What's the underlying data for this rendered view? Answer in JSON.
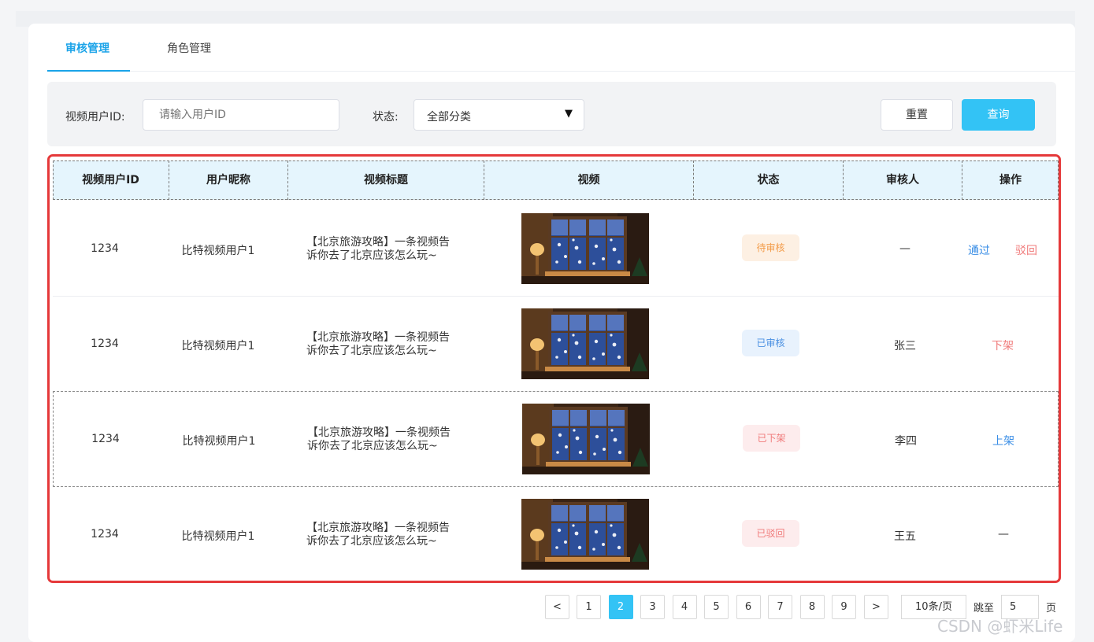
{
  "tabs": [
    {
      "label": "审核管理",
      "active": true
    },
    {
      "label": "角色管理",
      "active": false
    }
  ],
  "filter": {
    "user_id_label": "视频用户ID:",
    "user_id_placeholder": "请输入用户ID",
    "status_label": "状态:",
    "status_value": "全部分类",
    "reset_label": "重置",
    "query_label": "查询"
  },
  "table": {
    "headers": [
      "视频用户ID",
      "用户昵称",
      "视频标题",
      "视频",
      "状态",
      "审核人",
      "操作"
    ],
    "rows": [
      {
        "user_id": "1234",
        "nickname": "比特视频用户1",
        "title_line1": "【北京旅游攻略】一条视频告",
        "title_line2": "诉你去了北京应该怎么玩~",
        "status": "待审核",
        "reviewer": "—",
        "ops": [
          "通过",
          "驳回"
        ]
      },
      {
        "user_id": "1234",
        "nickname": "比特视频用户1",
        "title_line1": "【北京旅游攻略】一条视频告",
        "title_line2": "诉你去了北京应该怎么玩~",
        "status": "已审核",
        "reviewer": "张三",
        "ops": [
          "下架"
        ]
      },
      {
        "user_id": "1234",
        "nickname": "比特视频用户1",
        "title_line1": "【北京旅游攻略】一条视频告",
        "title_line2": "诉你去了北京应该怎么玩~",
        "status": "已下架",
        "reviewer": "李四",
        "ops": [
          "上架"
        ]
      },
      {
        "user_id": "1234",
        "nickname": "比特视频用户1",
        "title_line1": "【北京旅游攻略】一条视频告",
        "title_line2": "诉你去了北京应该怎么玩~",
        "status": "已驳回",
        "reviewer": "王五",
        "ops": [
          "—"
        ]
      }
    ]
  },
  "pagination": {
    "prev": "<",
    "pages": [
      "1",
      "2",
      "3",
      "4",
      "5",
      "6",
      "7",
      "8",
      "9"
    ],
    "current": "2",
    "next": ">",
    "page_size": "10条/页",
    "jump_label": "跳至",
    "jump_value": "5",
    "page_suffix": "页"
  },
  "watermark": "CSDN @虾米Life",
  "colors": {
    "accent": "#1aa3e8",
    "query_button": "#33c3f5",
    "highlight_border": "#e5393a",
    "header_bg": "#e5f5fd",
    "pending_bg": "#fdf0e3",
    "pending_text": "#f39c4a",
    "approved_bg": "#e8f2fd",
    "approved_text": "#4a90e2",
    "offline_bg": "#fdeced",
    "offline_text": "#f07b7b",
    "link_blue": "#3a8ee6",
    "link_red": "#f07b7b"
  }
}
